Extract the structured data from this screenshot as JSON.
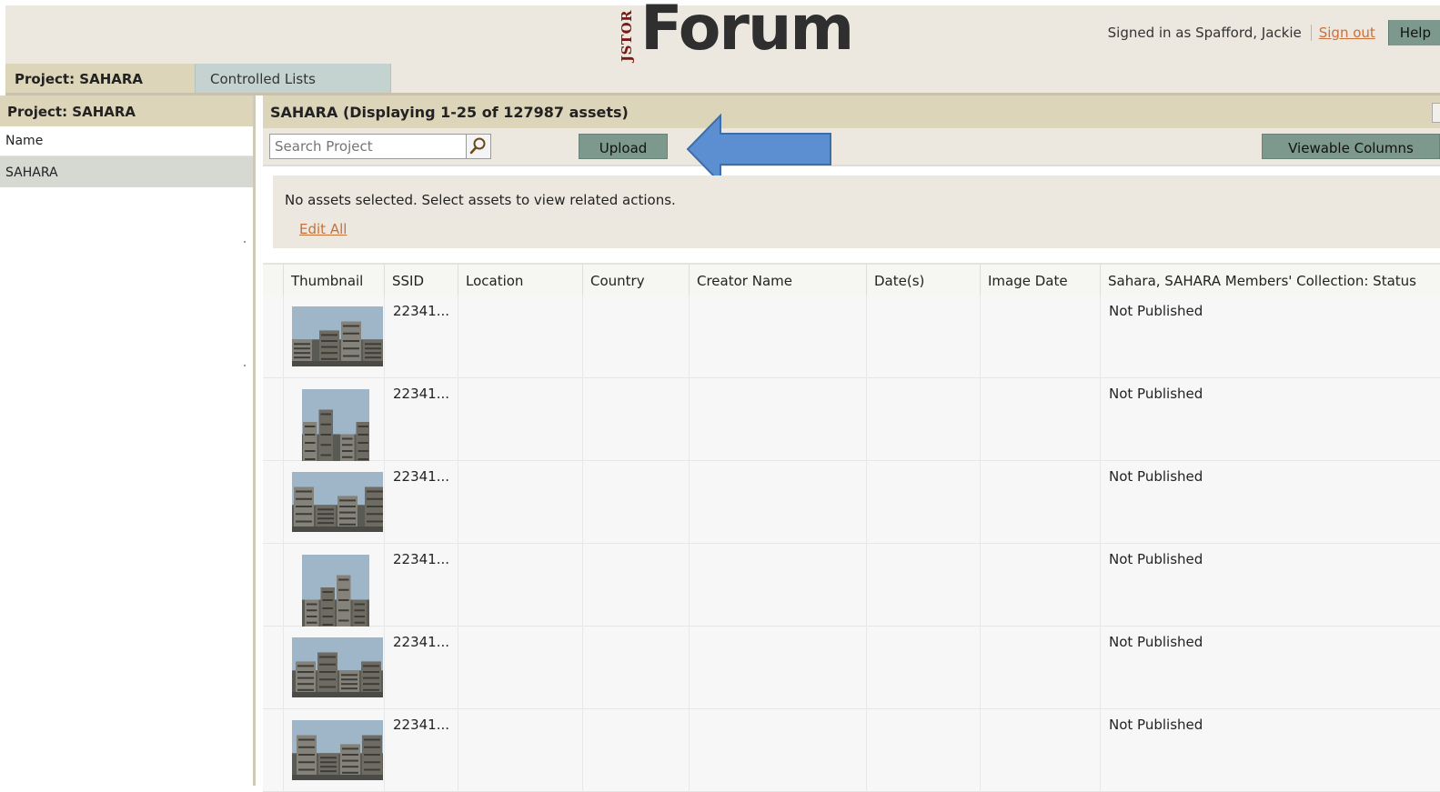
{
  "header": {
    "logo_side": "JSTOR",
    "logo_main": "Forum",
    "signed_in": "Signed in as Spafford, Jackie",
    "sign_out": "Sign out",
    "help": "Help"
  },
  "tabs": {
    "project": "Project: SAHARA",
    "controlled_lists": "Controlled Lists"
  },
  "sidebar": {
    "title": "Project: SAHARA",
    "column_header": "Name",
    "items": [
      {
        "label": "SAHARA"
      }
    ]
  },
  "main": {
    "title": "SAHARA (Displaying 1-25 of 127987 assets)",
    "search_placeholder": "Search Project",
    "upload_label": "Upload",
    "viewable_columns_label": "Viewable Columns",
    "notice": "No assets selected.  Select assets to view related actions.",
    "edit_all": "Edit All",
    "arrow_color": "#5b8fd1"
  },
  "table": {
    "columns": [
      "Thumbnail",
      "SSID",
      "Location",
      "Country",
      "Creator Name",
      "Date(s)",
      "Image Date",
      "Sahara, SAHARA Members' Collection: Status"
    ],
    "rows": [
      {
        "ssid": "22341...",
        "status": "Not Published",
        "thumb": "landscape"
      },
      {
        "ssid": "22341...",
        "status": "Not Published",
        "thumb": "portrait"
      },
      {
        "ssid": "22341...",
        "status": "Not Published",
        "thumb": "landscape"
      },
      {
        "ssid": "22341...",
        "status": "Not Published",
        "thumb": "portrait"
      },
      {
        "ssid": "22341...",
        "status": "Not Published",
        "thumb": "landscape"
      },
      {
        "ssid": "22341...",
        "status": "Not Published",
        "thumb": "landscape"
      }
    ]
  }
}
